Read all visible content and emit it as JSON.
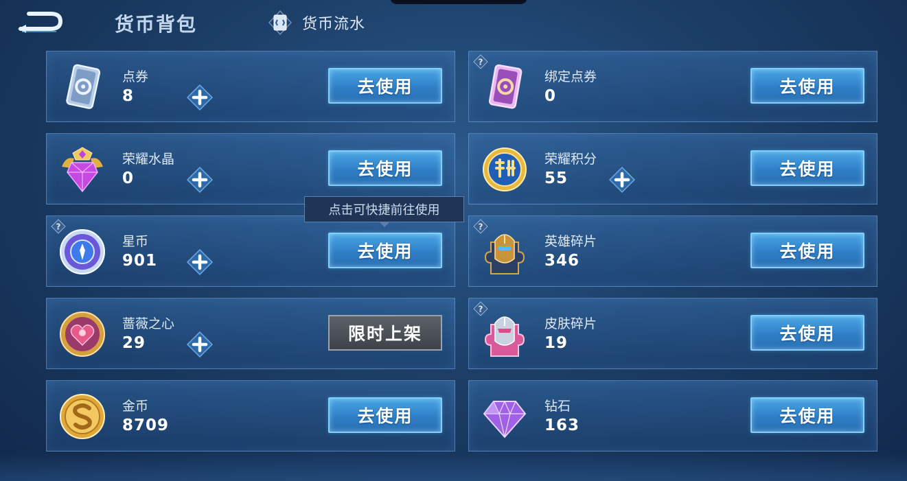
{
  "header": {
    "title": "货币背包",
    "flow_link": "货币流水",
    "back_icon": "back-arrow-icon",
    "flow_icon": "transaction-card-icon"
  },
  "tooltip": "点击可快捷前往使用",
  "use_label": "去使用",
  "limited_label": "限时上架",
  "colors": {
    "accent_button": "#3a92d8",
    "button_border": "#7fd0ff",
    "panel_border": "#78aae1",
    "background": "#1c3f68"
  },
  "currencies": [
    {
      "name": "点券",
      "amount": "8",
      "icon": "voucher-card-icon",
      "has_plus": true,
      "has_help": false,
      "action": "去使用"
    },
    {
      "name": "绑定点券",
      "amount": "0",
      "icon": "bound-voucher-card-icon",
      "has_plus": false,
      "has_help": true,
      "action": "去使用"
    },
    {
      "name": "荣耀水晶",
      "amount": "0",
      "icon": "glory-crystal-icon",
      "has_plus": true,
      "has_help": false,
      "action": "去使用"
    },
    {
      "name": "荣耀积分",
      "amount": "55",
      "icon": "glory-points-icon",
      "has_plus": true,
      "has_help": false,
      "action": "去使用"
    },
    {
      "name": "星币",
      "amount": "901",
      "icon": "star-coin-icon",
      "has_plus": true,
      "has_help": true,
      "action": "去使用"
    },
    {
      "name": "英雄碎片",
      "amount": "346",
      "icon": "hero-fragment-icon",
      "has_plus": false,
      "has_help": true,
      "action": "去使用"
    },
    {
      "name": "蔷薇之心",
      "amount": "29",
      "icon": "rose-heart-icon",
      "has_plus": true,
      "has_help": false,
      "action": "限时上架"
    },
    {
      "name": "皮肤碎片",
      "amount": "19",
      "icon": "skin-fragment-icon",
      "has_plus": false,
      "has_help": true,
      "action": "去使用"
    },
    {
      "name": "金币",
      "amount": "8709",
      "icon": "gold-coin-icon",
      "has_plus": false,
      "has_help": false,
      "action": "去使用"
    },
    {
      "name": "钻石",
      "amount": "163",
      "icon": "diamond-icon",
      "has_plus": false,
      "has_help": false,
      "action": "去使用"
    }
  ]
}
